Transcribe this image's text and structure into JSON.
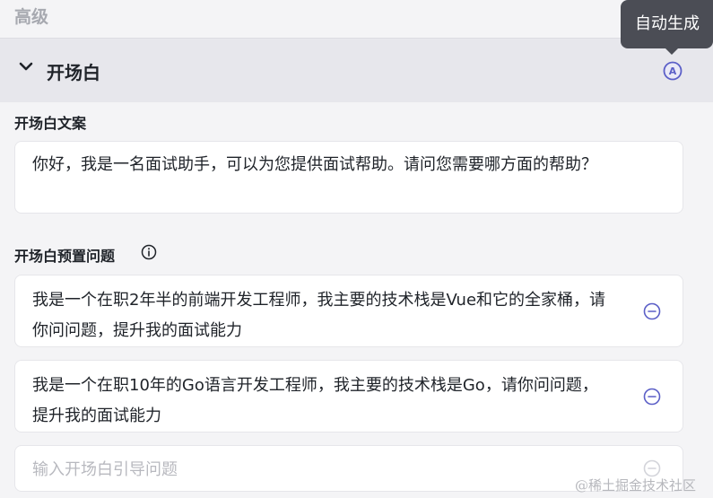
{
  "section_above": {
    "label": "高级"
  },
  "opening": {
    "title": "开场白",
    "auto_generate_tooltip": "自动生成",
    "copy_label": "开场白文案",
    "copy_text": "你好，我是一名面试助手，可以为您提供面试帮助。请问您需要哪方面的帮助？",
    "preset_label": "开场白预置问题",
    "questions": [
      {
        "text": "我是一个在职2年半的前端开发工程师，我主要的技术栈是Vue和它的全家桶，请你问问题，提升我的面试能力"
      },
      {
        "text": "我是一个在职10年的Go语言开发工程师，我主要的技术栈是Go，请你问问题，提升我的面试能力"
      }
    ],
    "new_question_placeholder": "输入开场白引导问题"
  },
  "watermark": "@稀土掘金技术社区",
  "colors": {
    "accent": "#5b5fc7",
    "tooltip_bg": "#4b4d55",
    "header_bg": "#e7e7ec",
    "page_bg": "#f4f4f6"
  },
  "icons": {
    "collapse": "chevron-down-icon",
    "auto_generate": "auto-generate-icon",
    "info": "info-icon",
    "remove": "minus-circle-icon"
  }
}
